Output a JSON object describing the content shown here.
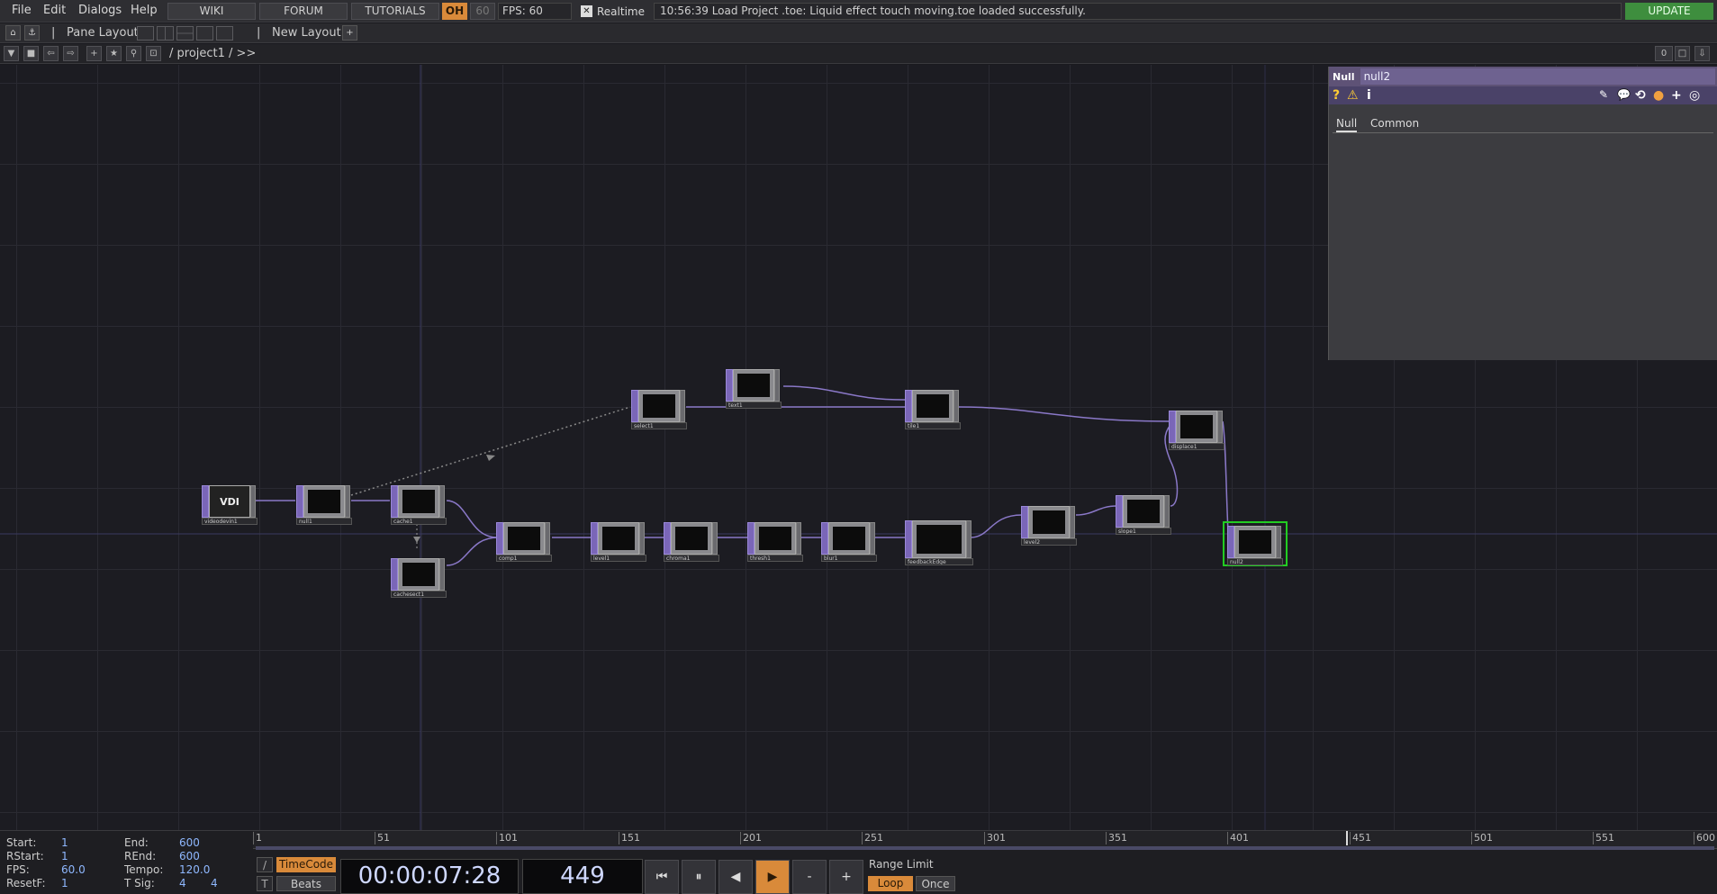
{
  "menubar": {
    "items": [
      "File",
      "Edit",
      "Dialogs",
      "Help"
    ],
    "wiki": "WIKI",
    "forum": "FORUM",
    "tutorials": "TUTORIALS",
    "oh_label": "OH",
    "sixty": "60",
    "fps_label": "FPS:  60",
    "realtime_check": "✕",
    "realtime": "Realtime",
    "status": "10:56:39 Load Project .toe: Liquid effect touch moving.toe loaded successfully.",
    "update": "UPDATE"
  },
  "layoutbar": {
    "pane_layout": "Pane Layout",
    "new_layout": "New Layout",
    "plus": "+",
    "sep": "|"
  },
  "pathbar": {
    "path": "/ project1 / >>",
    "count": "0"
  },
  "nodes": [
    {
      "name": "videodevin1",
      "label": "VDI"
    },
    {
      "name": "null1"
    },
    {
      "name": "cache1"
    },
    {
      "name": "cachesect1"
    },
    {
      "name": "select1"
    },
    {
      "name": "text1"
    },
    {
      "name": "tile1"
    },
    {
      "name": "comp1"
    },
    {
      "name": "level1"
    },
    {
      "name": "chroma1"
    },
    {
      "name": "thresh1"
    },
    {
      "name": "blur1"
    },
    {
      "name": "feedbackEdge"
    },
    {
      "name": "level2"
    },
    {
      "name": "slope1"
    },
    {
      "name": "displace1"
    },
    {
      "name": "null2"
    }
  ],
  "params": {
    "type": "Null",
    "name": "null2",
    "icons": [
      "?",
      "⚠",
      "i",
      "✎",
      "💬",
      "⟲",
      "●",
      "+",
      "◎"
    ],
    "tabs": [
      "Null",
      "Common"
    ]
  },
  "timeline": {
    "start_label": "Start:",
    "start": "1",
    "rstart_label": "RStart:",
    "rstart": "1",
    "fps_label": "FPS:",
    "fps": "60.0",
    "resetf_label": "ResetF:",
    "resetf": "1",
    "end_label": "End:",
    "end": "600",
    "rend_label": "REnd:",
    "rend": "600",
    "tempo_label": "Tempo:",
    "tempo": "120.0",
    "tsig_label": "T Sig:",
    "tsig_a": "4",
    "tsig_b": "4",
    "ticks": [
      "1",
      "51",
      "101",
      "151",
      "201",
      "251",
      "301",
      "351",
      "401",
      "451",
      "501",
      "551",
      "600"
    ],
    "timecode": "TimeCode",
    "beats": "Beats",
    "slash": "/",
    "t_label": "T",
    "tc_display": "00:00:07:28",
    "frame_display": "449",
    "range_limit": "Range Limit",
    "loop": "Loop",
    "once": "Once",
    "btn_start": "⏮",
    "btn_pause": "⏸",
    "btn_back": "◀",
    "btn_play": "▶",
    "btn_minus": "-",
    "btn_plus": "+"
  },
  "colors": {
    "accent": "#d98a3a",
    "update": "#3e8e3e",
    "operator_inlet": "#7a66b8",
    "selected": "#22cc22"
  }
}
